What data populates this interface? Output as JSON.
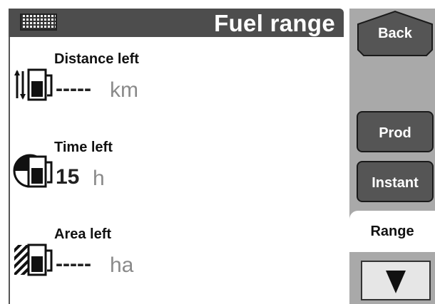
{
  "header": {
    "title": "Fuel range",
    "keypad_icon": "keypad-icon"
  },
  "rows": [
    {
      "label": "Distance left",
      "value": "-----",
      "unit": "km",
      "icon": "fuel-distance-icon"
    },
    {
      "label": "Time left",
      "value": "15",
      "unit": "h",
      "icon": "fuel-time-icon"
    },
    {
      "label": "Area left",
      "value": "-----",
      "unit": "ha",
      "icon": "fuel-area-icon"
    }
  ],
  "side": {
    "back_label": "Back",
    "prod_label": "Prod",
    "instant_label": "Instant",
    "range_label": "Range",
    "down_icon": "down-arrow-icon"
  },
  "colors": {
    "titlebar": "#4d4d4d",
    "panel": "#a9a9a9",
    "button": "#555555",
    "unit_text": "#8a8a8a"
  }
}
